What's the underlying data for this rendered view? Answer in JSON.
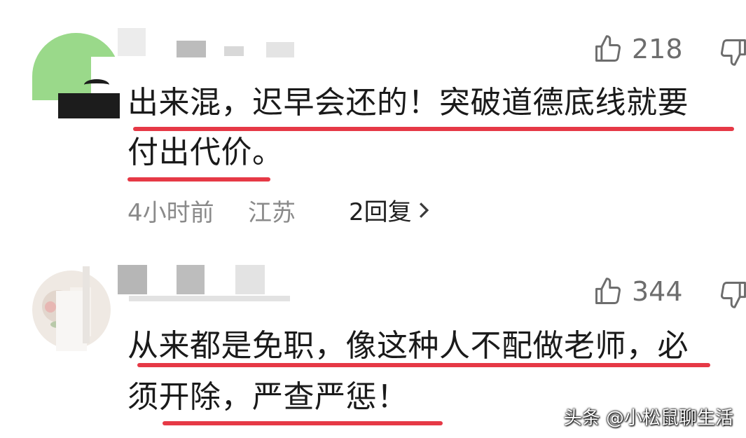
{
  "comments": [
    {
      "likes": "218",
      "text_line1": "出来混，迟早会还的！突破道德底线就要",
      "text_line2": "付出代价。",
      "time": "4小时前",
      "location": "江苏",
      "replies": "2回复"
    },
    {
      "likes": "344",
      "text_line1": "从来都是免职，像这种人不配做老师，必",
      "text_line2": "须开除，严查严惩！"
    }
  ],
  "icons": {
    "like": "thumbs-up-icon",
    "dislike": "thumbs-down-icon",
    "replies_arrow": "chevron-right-icon"
  },
  "colors": {
    "underline": "#e63946",
    "meta_text": "#8a8a8a",
    "avatar_green": "#9ad98a"
  },
  "watermark": "头条 @小松鼠聊生活"
}
